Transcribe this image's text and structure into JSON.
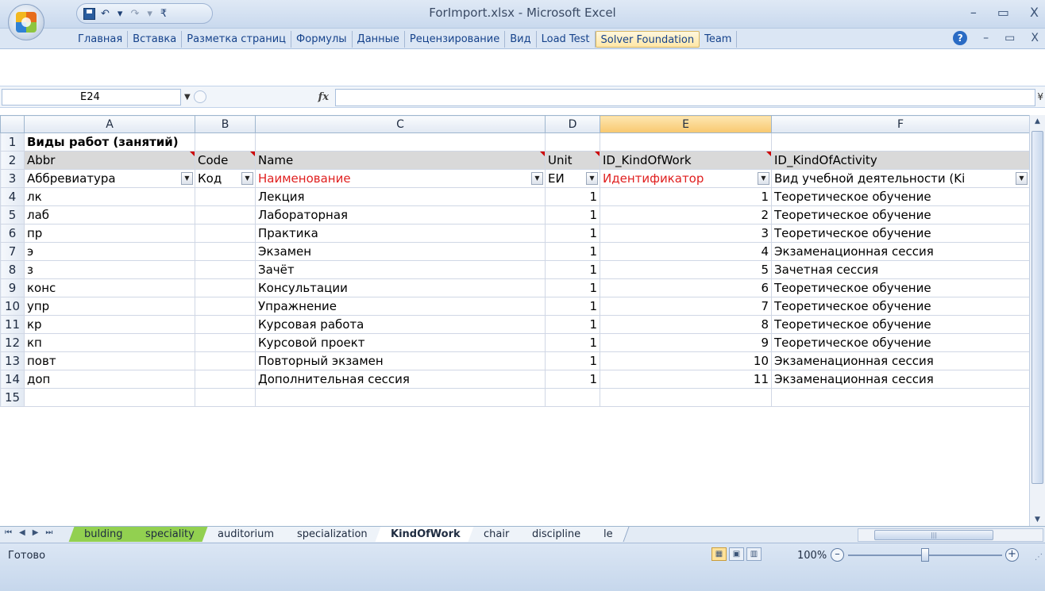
{
  "window": {
    "title": "ForImport.xlsx - Microsoft Excel",
    "minimize": "–",
    "restore": "▭",
    "close": "X"
  },
  "qat": {
    "undo": "↶",
    "undo_more": "▾",
    "redo": "↷",
    "redo_more": "▾",
    "customize": "₹"
  },
  "ribbon": {
    "tabs": [
      "Главная",
      "Вставка",
      "Разметка страниц",
      "Формулы",
      "Данные",
      "Рецензирование",
      "Вид",
      "Load Test",
      "Solver Foundation",
      "Team"
    ],
    "help": "?",
    "min": "–",
    "restore": "▭",
    "close": "X"
  },
  "formula_bar": {
    "name_box": "E24",
    "fx": "fx",
    "value": "",
    "expand": "¥"
  },
  "columns": [
    "A",
    "B",
    "C",
    "D",
    "E",
    "F"
  ],
  "selected_column": "E",
  "rows": [
    {
      "n": "1",
      "cells": [
        "Виды работ (занятий)",
        "",
        "",
        "",
        "",
        ""
      ]
    },
    {
      "n": "2",
      "cells": [
        "Abbr",
        "Code",
        "Name",
        "Unit",
        "ID_KindOfWork",
        "ID_KindOfActivity"
      ]
    },
    {
      "n": "3",
      "cells": [
        "Аббревиатура",
        "Код",
        "Наименование",
        "ЕИ",
        "Идентификатор",
        "Вид учебной деятельности (Ki"
      ]
    },
    {
      "n": "4",
      "cells": [
        "лк",
        "",
        "Лекция",
        "1",
        "1",
        "Теоретическое обучение"
      ]
    },
    {
      "n": "5",
      "cells": [
        "лаб",
        "",
        "Лабораторная",
        "1",
        "2",
        "Теоретическое обучение"
      ]
    },
    {
      "n": "6",
      "cells": [
        "пр",
        "",
        "Практика",
        "1",
        "3",
        "Теоретическое обучение"
      ]
    },
    {
      "n": "7",
      "cells": [
        "э",
        "",
        "Экзамен",
        "1",
        "4",
        "Экзаменационная сессия"
      ]
    },
    {
      "n": "8",
      "cells": [
        "з",
        "",
        "Зачёт",
        "1",
        "5",
        "Зачетная сессия"
      ]
    },
    {
      "n": "9",
      "cells": [
        "конс",
        "",
        "Консультации",
        "1",
        "6",
        "Теоретическое обучение"
      ]
    },
    {
      "n": "10",
      "cells": [
        "упр",
        "",
        "Упражнение",
        "1",
        "7",
        "Теоретическое обучение"
      ]
    },
    {
      "n": "11",
      "cells": [
        "кр",
        "",
        "Курсовая работа",
        "1",
        "8",
        "Теоретическое обучение"
      ]
    },
    {
      "n": "12",
      "cells": [
        "кп",
        "",
        "Курсовой проект",
        "1",
        "9",
        "Теоретическое обучение"
      ]
    },
    {
      "n": "13",
      "cells": [
        "повт",
        "",
        "Повторный экзамен",
        "1",
        "10",
        "Экзаменационная сессия"
      ]
    },
    {
      "n": "14",
      "cells": [
        "доп",
        "",
        "Дополнительная сессия",
        "1",
        "11",
        "Экзаменационная сессия"
      ]
    },
    {
      "n": "15",
      "cells": [
        "",
        "",
        "",
        "",
        "",
        ""
      ]
    }
  ],
  "sheet_nav": [
    "⏮",
    "◀",
    "▶",
    "⏭"
  ],
  "sheets": [
    {
      "label": "bulding",
      "style": "green"
    },
    {
      "label": "speciality",
      "style": "green"
    },
    {
      "label": "auditorium",
      "style": "normal"
    },
    {
      "label": "specialization",
      "style": "normal"
    },
    {
      "label": "KindOfWork",
      "style": "active"
    },
    {
      "label": "chair",
      "style": "normal"
    },
    {
      "label": "discipline",
      "style": "normal"
    },
    {
      "label": "le",
      "style": "normal"
    }
  ],
  "status": {
    "text": "Готово",
    "zoom": "100%",
    "zoom_level_pct": 100,
    "zoom_out": "–",
    "zoom_in": "+"
  },
  "colors": {
    "header_fill": "#d9d9d9",
    "required_text": "#e02020",
    "green_tab": "#92d050",
    "selected_col": "#f8c86f"
  }
}
